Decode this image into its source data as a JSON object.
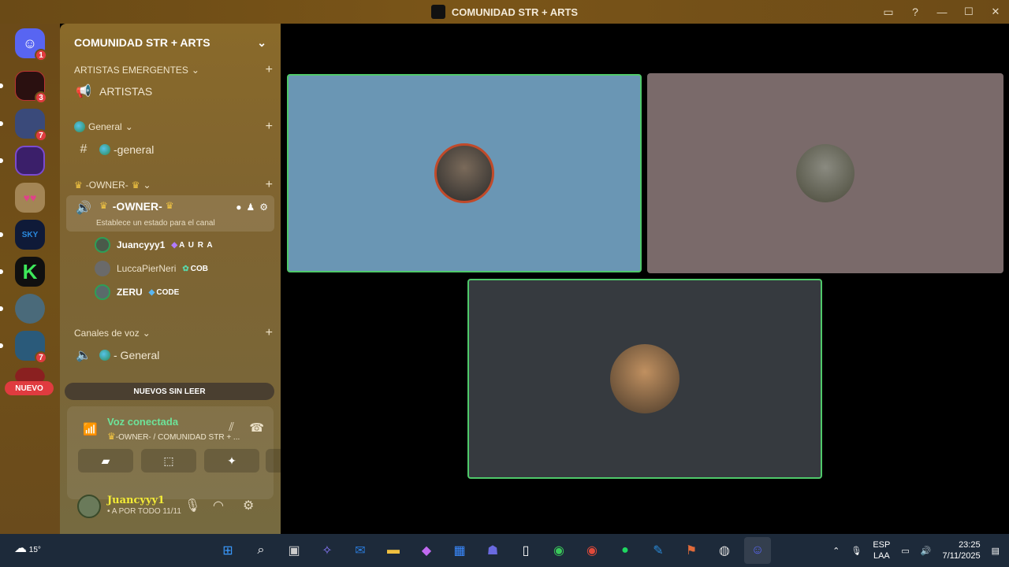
{
  "window": {
    "title": "COMUNIDAD STR + ARTS",
    "controls": [
      "inbox-icon",
      "help-icon",
      "minimize-icon",
      "maximize-icon",
      "close-icon"
    ]
  },
  "servers": [
    {
      "name": "discord-home",
      "badge": "1",
      "color": "#5865f2"
    },
    {
      "name": "server-1",
      "badge": "3",
      "color": "#2a1010"
    },
    {
      "name": "server-2",
      "badge": "7",
      "color": "#3a4a7a"
    },
    {
      "name": "server-cosco",
      "badge": "",
      "color": "#3b1f6a"
    },
    {
      "name": "server-hearts",
      "badge": "",
      "color": "#9b7a4a"
    },
    {
      "name": "server-sky",
      "badge": "",
      "color": "#0f1a38"
    },
    {
      "name": "server-k",
      "badge": "",
      "color": "#101010"
    },
    {
      "name": "server-anime",
      "badge": "",
      "color": "#4a6a7a"
    },
    {
      "name": "server-avatar",
      "badge": "7",
      "color": "#2a5a7a"
    },
    {
      "name": "server-red",
      "badge": "",
      "color": "#8a2020"
    }
  ],
  "rail": {
    "new_label": "NUEVO"
  },
  "sidebar": {
    "server_name": "COMUNIDAD STR + ARTS",
    "categories": [
      {
        "label": "ARTISTAS EMERGENTES",
        "channel": "ARTISTAS"
      },
      {
        "label": "General",
        "channel": "-general"
      },
      {
        "label": "-OWNER-",
        "channel": "-OWNER-"
      },
      {
        "label": "Canales de voz",
        "channel": "- General"
      }
    ],
    "owner_status": "Establece un estado para el canal",
    "voice_users": [
      {
        "name": "Juancyyy1",
        "tag": "A U R A"
      },
      {
        "name": "LuccaPierNeri",
        "tag": "COB"
      },
      {
        "name": "ZERU",
        "tag": "CODE"
      }
    ],
    "unread_label": "NUEVOS SIN LEER"
  },
  "voice_panel": {
    "title": "Voz conectada",
    "subtitle": "-OWNER- / COMUNIDAD STR + ..."
  },
  "user": {
    "name": "Juancyyy1",
    "status": "• A POR TODO 11/11"
  },
  "taskbar": {
    "weather": "15°",
    "lang_top": "ESP",
    "lang_bottom": "LAA",
    "time": "23:25",
    "date": "7/11/2025"
  },
  "colors": {
    "speaking": "#4fc96a",
    "tile_blue": "#6a96b4",
    "tile_mauve": "#7a6a6a",
    "tile_dark": "#363a3f",
    "badge": "#e03b3f"
  }
}
